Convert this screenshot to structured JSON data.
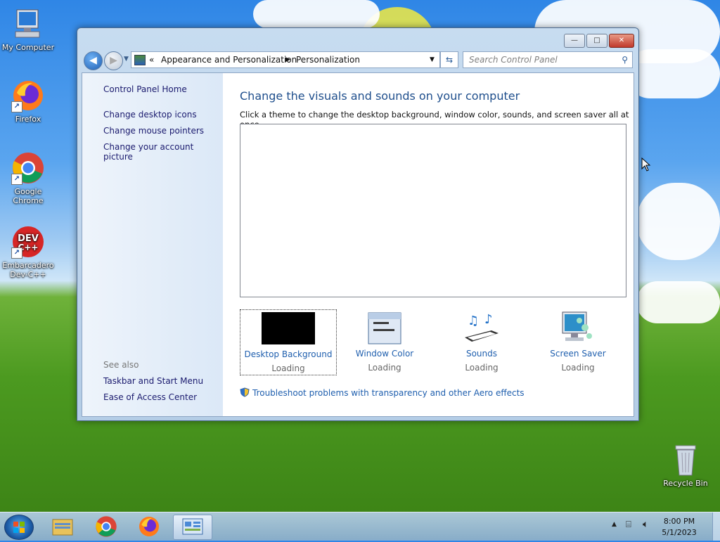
{
  "desktop": {
    "icons": [
      {
        "label": "My Computer"
      },
      {
        "label": "Firefox"
      },
      {
        "label": "Google Chrome"
      },
      {
        "label": "Embarcadero Dev-C++"
      },
      {
        "label": "Recycle Bin"
      }
    ]
  },
  "window": {
    "breadcrumb": {
      "overflow": "«",
      "items": [
        "Appearance and Personalization",
        "Personalization"
      ]
    },
    "search_placeholder": "Search Control Panel",
    "controls": {
      "minimize": "—",
      "maximize": "□",
      "close": "✕"
    },
    "left_pane": {
      "home": "Control Panel Home",
      "links": [
        "Change desktop icons",
        "Change mouse pointers",
        "Change your account picture"
      ],
      "see_also_heading": "See also",
      "see_also": [
        "Taskbar and Start Menu",
        "Ease of Access Center"
      ]
    },
    "main": {
      "title": "Change the visuals and sounds on your computer",
      "subtitle": "Click a theme to change the desktop background, window color, sounds, and screen saver all at once.",
      "tiles": [
        {
          "label": "Desktop Background",
          "status": "Loading"
        },
        {
          "label": "Window Color",
          "status": "Loading"
        },
        {
          "label": "Sounds",
          "status": "Loading"
        },
        {
          "label": "Screen Saver",
          "status": "Loading"
        }
      ],
      "troubleshoot_link": "Troubleshoot problems with transparency and other Aero effects"
    }
  },
  "taskbar": {
    "time": "8:00 PM",
    "date": "5/1/2023"
  }
}
